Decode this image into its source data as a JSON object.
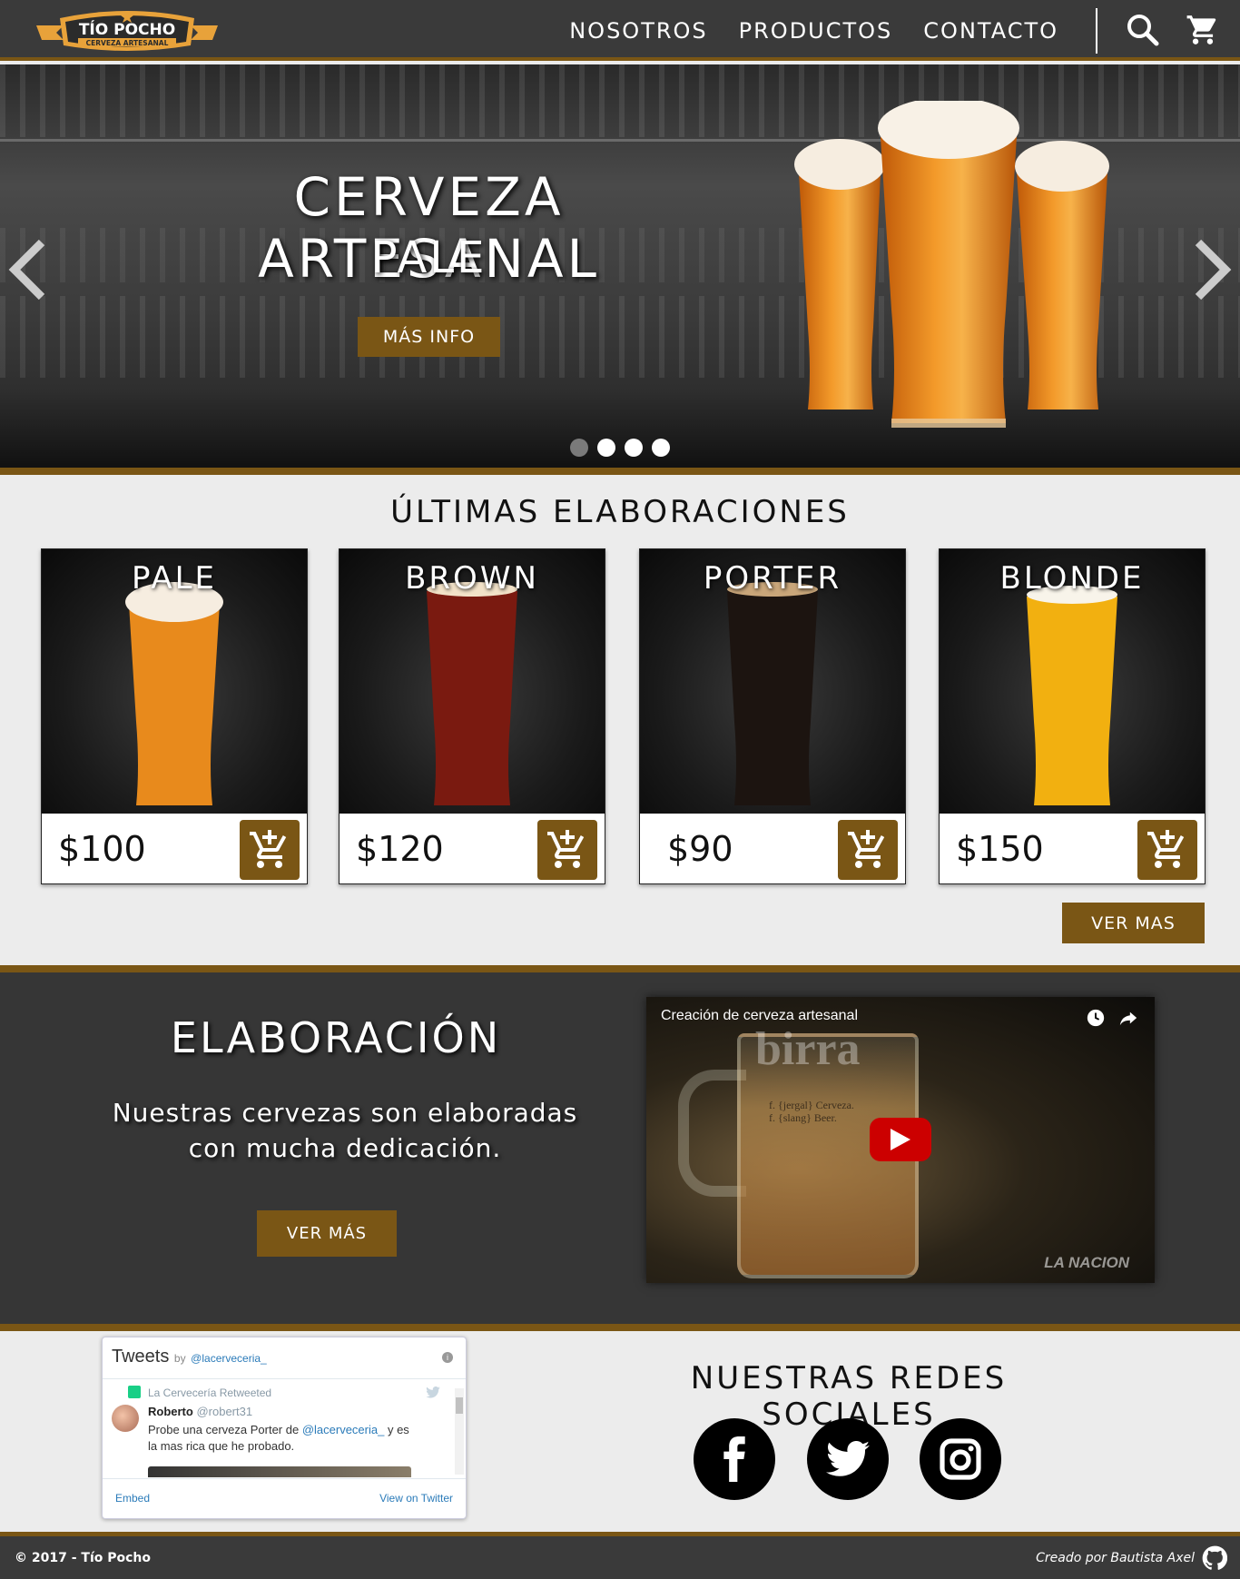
{
  "brand": {
    "name": "TÍO POCHO",
    "tagline": "CERVEZA ARTESANAL"
  },
  "nav": {
    "items": [
      {
        "label": "NOSOTROS"
      },
      {
        "label": "PRODUCTOS"
      },
      {
        "label": "CONTACTO"
      }
    ],
    "icons": [
      "search-icon",
      "cart-icon"
    ]
  },
  "hero": {
    "title": "CERVEZA ARTESANAL",
    "subtitle": "PALE",
    "button": "MÁS INFO",
    "slides": 4,
    "active_slide": 1
  },
  "products": {
    "title": "ÚLTIMAS ELABORACIONES",
    "items": [
      {
        "name": "PALE",
        "price": "$100",
        "color": "#e88a1c"
      },
      {
        "name": "BROWN",
        "price": "$120",
        "color": "#7a1a10"
      },
      {
        "name": "PORTER",
        "price": "$90",
        "color": "#1c1410"
      },
      {
        "name": "BLONDE",
        "price": "$150",
        "color": "#f2b010"
      }
    ],
    "more_button": "VER MAS"
  },
  "elaboracion": {
    "title": "ELABORACIÓN",
    "text_line1": "Nuestras cervezas son elaboradas",
    "text_line2": "con mucha dedicación.",
    "button": "VER MÁS",
    "video": {
      "title": "Creación de cerveza artesanal",
      "mug_word": "birra",
      "mug_def1": "f. {jergal} Cerveza.",
      "mug_def2": "f. {slang} Beer.",
      "watermark": "LA NACION"
    }
  },
  "twitter": {
    "header": "Tweets",
    "by": "by",
    "handle": "@lacerveceria_",
    "retweeted": "La Cervecería Retweeted",
    "user_name": "Roberto",
    "user_handle": "@robert31",
    "text_before": "Probe una cerveza Porter de ",
    "text_mention": "@lacerveceria_",
    "text_after": " y es la mas rica que he probado.",
    "embed": "Embed",
    "view": "View on Twitter"
  },
  "social": {
    "title": "NUESTRAS REDES SOCIALES",
    "networks": [
      "facebook-icon",
      "twitter-icon",
      "instagram-icon"
    ]
  },
  "footer": {
    "copyright": "© 2017 - Tío Pocho",
    "credit": "Creado por Bautista Axel"
  },
  "colors": {
    "accent": "#7a5615",
    "dark": "#3a3a3a",
    "light": "#ececec"
  }
}
